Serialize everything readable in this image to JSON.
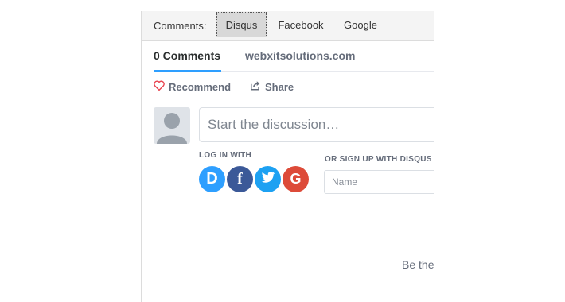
{
  "tabs": {
    "label": "Comments:",
    "items": [
      {
        "label": "Disqus",
        "active": true
      },
      {
        "label": "Facebook",
        "active": false
      },
      {
        "label": "Google",
        "active": false
      }
    ]
  },
  "nav": {
    "comment_count": "0 Comments",
    "site_name": "webxitsolutions.com"
  },
  "actions": {
    "recommend": "Recommend",
    "share": "Share"
  },
  "compose": {
    "placeholder": "Start the discussion…"
  },
  "login": {
    "label": "LOG IN WITH",
    "providers": [
      "D",
      "f",
      "G"
    ],
    "provider_icons": [
      "disqus-icon",
      "facebook-icon",
      "twitter-icon",
      "google-icon"
    ]
  },
  "signup": {
    "label": "OR SIGN UP WITH DISQUS",
    "name_placeholder": "Name"
  },
  "empty_state": {
    "text": "Be the"
  },
  "colors": {
    "accent": "#2e9fff",
    "heart": "#e8414d",
    "facebook": "#3b5998",
    "twitter": "#1da1f2",
    "google": "#dd4b39"
  }
}
